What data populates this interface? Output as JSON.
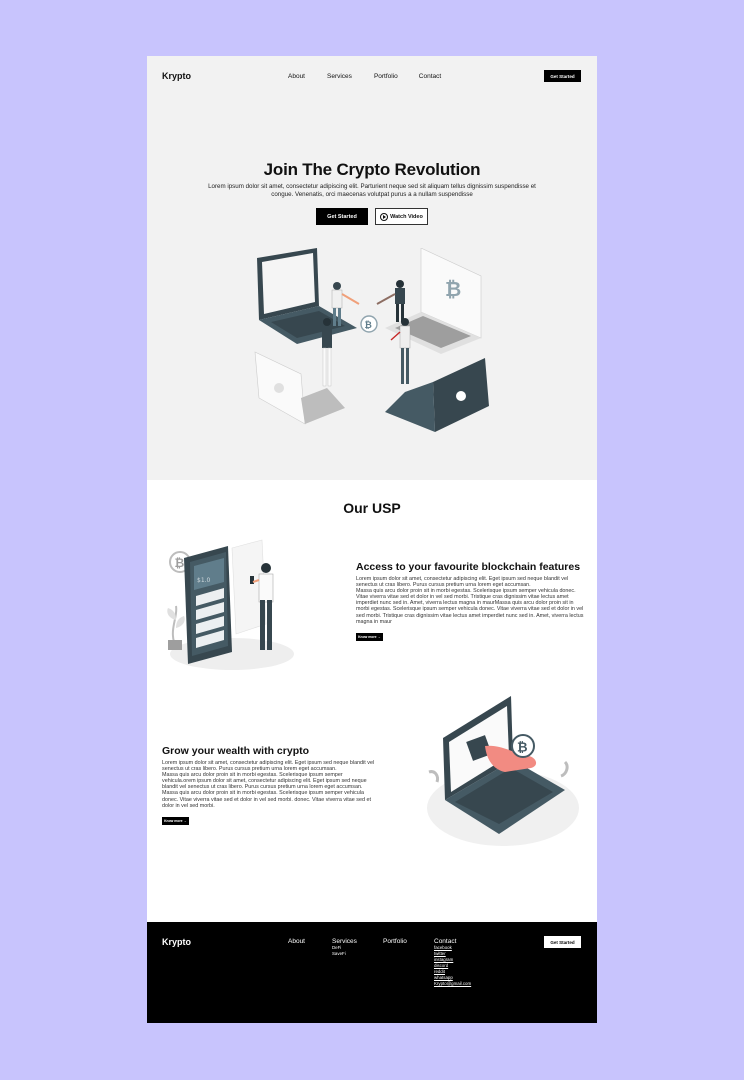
{
  "nav": {
    "logo": "Krypto",
    "links": [
      "About",
      "Services",
      "Portfolio",
      "Contact"
    ],
    "cta": "Get Started"
  },
  "hero": {
    "title": "Join The Crypto Revolution",
    "subtitle": "Lorem ipsum dolor sit amet, consectetur adipiscing elit. Parturient neque sed sit aliquam tellus dignissim suspendisse et congue. Venenatis, orci maecenas volutpat purus a a nullam suspendisse",
    "primary_button": "Get Started",
    "secondary_button": "Watch Video"
  },
  "usp": {
    "title": "Our USP",
    "items": [
      {
        "heading": "Access to your favourite blockchain features",
        "body": "Lorem ipsum dolor sit amet, consectetur adipiscing elit. Eget ipsum sed neque blandit vel senectus ut cras libero. Purus cursus pretium urna lorem eget accumsan.\nMassa quis arcu dolor proin sit in morbi egestas. Scelerisque ipsum semper vehicula donec. Vitae viverra vitae sed et dolor in vel sed morbi. Tristique cras dignissim vitae lectus amet imperdiet nunc sed in. Amet, viverra lectus magna in maurMassa quis arcu dolor proin sit in morbi egestas. Scelerisque ipsum semper vehicula donec. Vitae viverra vitae sed et dolor in vel sed morbi. Tristique cras dignissim vitae lectus amet imperdiet nunc sed in. Amet, viverra lectus magna in maur",
        "button": "Know more →"
      },
      {
        "heading": "Grow your wealth with crypto",
        "body": "Lorem ipsum dolor sit amet, consectetur adipiscing elit. Eget ipsum sed neque blandit vel senectus ut cras libero. Purus cursus pretium urna lorem eget accumsan.\nMassa quis arcu dolor proin sit in morbi egestas. Scelerisque ipsum semper vehicula.orem ipsum dolor sit amet, consectetur adipiscing elit. Eget ipsum sed neque blandit vel senectus ut cras libero. Purus cursus pretium urna lorem eget accumsan.\nMassa quis arcu dolor proin sit in morbi egestas. Scelerisque ipsum semper vehicula donec. Vitae viverra vitae sed et dolor in vel sed morbi.  donec. Vitae viverra vitae sed et dolor in vel sed morbi.",
        "button": "Know more →"
      }
    ]
  },
  "footer": {
    "logo": "Krypto",
    "about": "About",
    "services": {
      "label": "Services",
      "items": [
        "DeFi",
        "SaveFi"
      ]
    },
    "portfolio": "Portfolio",
    "contact": {
      "label": "Contact",
      "items": [
        "facebook",
        "twitter",
        "instagram",
        "discord",
        "reddit",
        "whatsapp",
        "Krypto@gmail.com"
      ]
    },
    "cta": "Get Started"
  }
}
